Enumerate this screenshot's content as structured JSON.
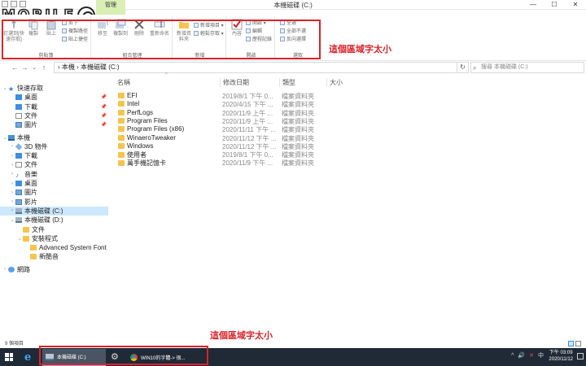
{
  "window": {
    "title": "本機磁碟 (C:)",
    "manage_tab": "管理",
    "controls": [
      "—",
      "☐",
      "✕"
    ]
  },
  "logo": {
    "text": "MOBILE"
  },
  "ribbon": {
    "groups": [
      {
        "label": "剪貼簿",
        "buttons": [
          "釘選到[快速存取]",
          "複製",
          "貼上"
        ],
        "small": [
          "剪下",
          "複製路徑",
          "貼上捷徑"
        ]
      },
      {
        "label": "組合管理",
        "buttons": [
          "移至",
          "複製到",
          "刪除",
          "重新命名"
        ]
      },
      {
        "label": "新增",
        "buttons": [
          "新增資料夾"
        ],
        "small": [
          "新增項目 ▾",
          "輕鬆存取 ▾"
        ]
      },
      {
        "label": "開啟",
        "buttons": [
          "內容"
        ],
        "small": [
          "開啟 ▾",
          "編輯",
          "歷程記錄"
        ]
      },
      {
        "label": "選取",
        "small": [
          "全選",
          "全部不選",
          "反向選擇"
        ]
      }
    ]
  },
  "annotations": {
    "ribbon_note": "這個區域字太小",
    "taskbar_note": "這個區域字太小"
  },
  "address": {
    "path": "›  本機  ›  本機磁碟 (C:)",
    "search_placeholder": "搜尋 本機磁碟 (C:)",
    "nav": {
      "back": "←",
      "forward": "→",
      "recent": "⌄",
      "up": "↑",
      "refresh": "↻"
    }
  },
  "navpane": {
    "items": [
      {
        "label": "快速存取",
        "icon": "star-icon",
        "chev": "⌄",
        "indent": 0
      },
      {
        "label": "桌面",
        "icon": "desktop-icon",
        "chev": "",
        "indent": 1,
        "pin": true
      },
      {
        "label": "下載",
        "icon": "download-icon",
        "chev": "",
        "indent": 1,
        "pin": true
      },
      {
        "label": "文件",
        "icon": "document-icon",
        "chev": "",
        "indent": 1,
        "pin": true
      },
      {
        "label": "圖片",
        "icon": "picture-icon",
        "chev": "",
        "indent": 1,
        "pin": true
      },
      {
        "label": "本機",
        "icon": "computer-icon",
        "chev": "⌄",
        "indent": 0,
        "gap": true
      },
      {
        "label": "3D 物件",
        "icon": "3d-objects-icon",
        "chev": "›",
        "indent": 1
      },
      {
        "label": "下載",
        "icon": "download-icon",
        "chev": "›",
        "indent": 1
      },
      {
        "label": "文件",
        "icon": "document-icon",
        "chev": "›",
        "indent": 1
      },
      {
        "label": "音樂",
        "icon": "music-icon",
        "chev": "›",
        "indent": 1
      },
      {
        "label": "桌面",
        "icon": "desktop-icon",
        "chev": "›",
        "indent": 1
      },
      {
        "label": "圖片",
        "icon": "picture-icon",
        "chev": "›",
        "indent": 1
      },
      {
        "label": "影片",
        "icon": "video-icon",
        "chev": "›",
        "indent": 1
      },
      {
        "label": "本機磁碟 (C:)",
        "icon": "drive-icon",
        "chev": "›",
        "indent": 1,
        "selected": true
      },
      {
        "label": "本機磁碟 (D:)",
        "icon": "drive-icon",
        "chev": "⌄",
        "indent": 1
      },
      {
        "label": "文件",
        "icon": "folder-icon",
        "chev": "",
        "indent": 2
      },
      {
        "label": "安裝程式",
        "icon": "folder-icon",
        "chev": "⌄",
        "indent": 2
      },
      {
        "label": "Advanced System Font Ch",
        "icon": "folder-icon",
        "chev": "",
        "indent": 3
      },
      {
        "label": "新酷音",
        "icon": "folder-icon",
        "chev": "",
        "indent": 3
      },
      {
        "label": "網路",
        "icon": "network-icon",
        "chev": "›",
        "indent": 0,
        "gap": true
      }
    ]
  },
  "filelist": {
    "columns": [
      "名稱",
      "修改日期",
      "類型",
      "大小"
    ],
    "rows": [
      {
        "name": "EFI",
        "date": "2019/8/1 下午 0...",
        "type": "檔案資料夾"
      },
      {
        "name": "Intel",
        "date": "2020/4/15 下午 ...",
        "type": "檔案資料夾"
      },
      {
        "name": "PerfLogs",
        "date": "2020/11/9 上午 ...",
        "type": "檔案資料夾"
      },
      {
        "name": "Program Files",
        "date": "2020/11/9 上午 ...",
        "type": "檔案資料夾"
      },
      {
        "name": "Program Files (x86)",
        "date": "2020/11/11 下午 ...",
        "type": "檔案資料夾"
      },
      {
        "name": "WinaeroTweaker",
        "date": "2020/11/12 下午 ...",
        "type": "檔案資料夾"
      },
      {
        "name": "Windows",
        "date": "2020/11/12 下午 ...",
        "type": "檔案資料夾"
      },
      {
        "name": "使用者",
        "date": "2019/8/1 下午 0...",
        "type": "檔案資料夾"
      },
      {
        "name": "萬手機記憶卡",
        "date": "2020/11/9 下午 ...",
        "type": "檔案資料夾"
      }
    ]
  },
  "status": {
    "count": "9 個項目"
  },
  "taskbar": {
    "explorer_label": "本機磁碟 (C:)",
    "chrome_label": "WIN10的字體-> 很...",
    "tray": [
      "^",
      "🔊",
      "✕",
      "中"
    ],
    "time": "下午 03:09",
    "date": "2020/11/12"
  },
  "colors": {
    "annotation_red": "#d8232a",
    "selection_blue": "#cce8ff",
    "manage_tab_green": "#d9efb4",
    "taskbar_bg": "#1f2a36",
    "folder_yellow": "#f6c44f"
  }
}
